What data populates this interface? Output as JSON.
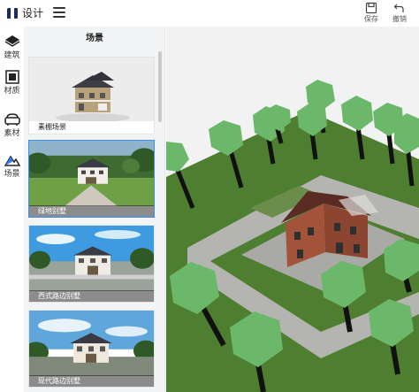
{
  "app": {
    "title": "设计"
  },
  "toolbar": {
    "save_label": "保存",
    "undo_label": "撤销"
  },
  "rail": {
    "items": [
      {
        "label": "建筑",
        "icon": "building-icon"
      },
      {
        "label": "材质",
        "icon": "material-icon"
      },
      {
        "label": "素材",
        "icon": "sofa-icon"
      },
      {
        "label": "场景",
        "icon": "scene-icon"
      }
    ]
  },
  "panel": {
    "title": "场景",
    "cards": [
      {
        "label": "素棚场景"
      },
      {
        "label": "绿地别墅"
      },
      {
        "label": "西式路边别墅"
      },
      {
        "label": "现代路边别墅"
      }
    ]
  },
  "colors": {
    "accent": "#3b8ff3",
    "grass": "#4e7e30",
    "tree": "#6cb86a"
  }
}
